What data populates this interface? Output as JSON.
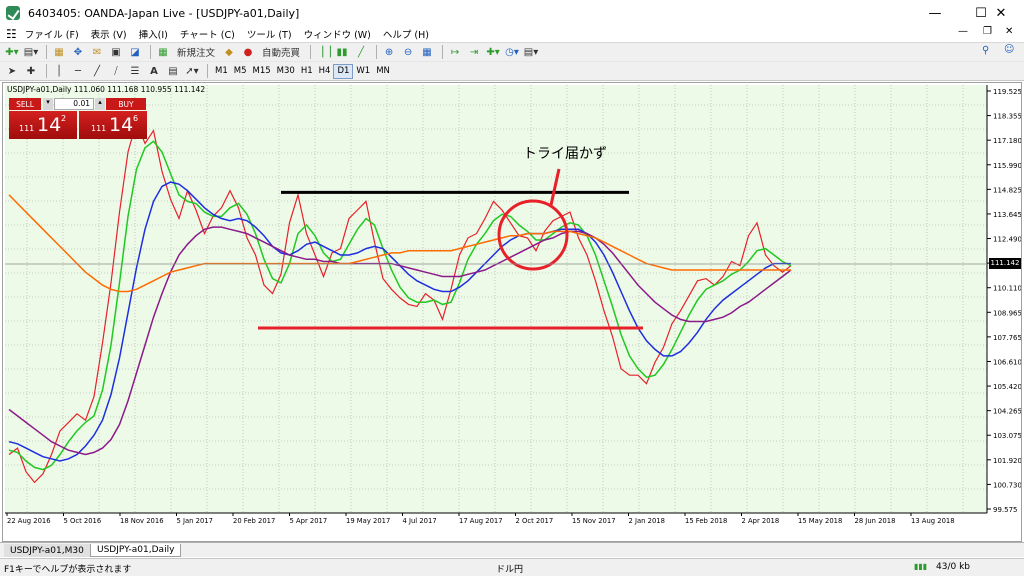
{
  "window": {
    "title": "6403405: OANDA-Japan Live - [USDJPY-a01,Daily]"
  },
  "menu": [
    "ファイル (F)",
    "表示 (V)",
    "挿入(I)",
    "チャート (C)",
    "ツール (T)",
    "ウィンドウ (W)",
    "ヘルプ (H)"
  ],
  "toolbar": {
    "new_order": "新規注文",
    "auto_trade": "自動売買"
  },
  "timeframes": [
    "M1",
    "M5",
    "M15",
    "M30",
    "H1",
    "H4",
    "D1",
    "W1",
    "MN"
  ],
  "active_timeframe": "D1",
  "chart": {
    "symbol_label": "USDJPY-a01,Daily",
    "ohlc": "111.060 111.168 110.955 111.142",
    "trade_panel": {
      "sell_label": "SELL",
      "buy_label": "BUY",
      "lot": "0.01",
      "sell_prefix": "111",
      "sell_big": "14",
      "sell_sup": "2",
      "buy_prefix": "111",
      "buy_big": "14",
      "buy_sup": "6"
    },
    "annotation": "トライ届かず",
    "current_price": "111.142"
  },
  "chart_data": {
    "type": "line",
    "price_axis_labels": [
      "119.525",
      "118.355",
      "117.180",
      "115.990",
      "114.825",
      "113.645",
      "112.490",
      "111.142",
      "110.110",
      "108.965",
      "107.765",
      "106.610",
      "105.420",
      "104.265",
      "103.075",
      "101.920",
      "100.730",
      "99.575"
    ],
    "date_axis_labels": [
      "22 Aug 2016",
      "5 Oct 2016",
      "18 Nov 2016",
      "5 Jan 2017",
      "20 Feb 2017",
      "5 Apr 2017",
      "19 May 2017",
      "4 Jul 2017",
      "17 Aug 2017",
      "2 Oct 2017",
      "15 Nov 2017",
      "2 Jan 2018",
      "15 Feb 2018",
      "2 Apr 2018",
      "15 May 2018",
      "28 Jun 2018",
      "13 Aug 2018"
    ],
    "ylim": [
      99.575,
      119.525
    ],
    "grid": true,
    "horizontal_lines": [
      {
        "price": 114.52,
        "color": "#000000"
      },
      {
        "price": 108.2,
        "color": "#e8202a"
      }
    ],
    "series": [
      {
        "color": "#e8202a",
        "values": [
          102.3,
          102.6,
          101.5,
          101.0,
          101.4,
          102.3,
          103.4,
          103.8,
          104.2,
          103.9,
          105.0,
          107.5,
          110.3,
          113.6,
          116.4,
          117.8,
          116.8,
          117.4,
          115.5,
          114.2,
          113.3,
          114.6,
          113.7,
          112.6,
          113.4,
          113.8,
          114.6,
          113.8,
          112.4,
          111.6,
          110.2,
          109.8,
          110.7,
          113.1,
          114.4,
          112.6,
          111.6,
          110.6,
          111.7,
          111.9,
          113.3,
          113.7,
          114.1,
          112.2,
          110.5,
          110.0,
          109.6,
          109.3,
          109.2,
          109.8,
          109.5,
          108.6,
          110.0,
          111.6,
          112.4,
          112.6,
          113.3,
          114.1,
          113.7,
          113.1,
          112.5,
          112.4,
          111.8,
          112.7,
          113.2,
          113.4,
          113.6,
          112.4,
          111.6,
          110.4,
          109.0,
          107.8,
          106.3,
          106.0,
          106.0,
          105.6,
          106.6,
          107.3,
          108.4,
          109.0,
          109.7,
          110.4,
          110.5,
          110.2,
          110.6,
          111.3,
          111.1,
          112.5,
          113.1,
          111.6,
          111.1,
          110.8,
          111.1
        ]
      },
      {
        "color": "#22c822",
        "values": [
          102.5,
          102.4,
          102.0,
          101.7,
          101.6,
          101.8,
          102.3,
          102.9,
          103.4,
          103.8,
          104.1,
          105.3,
          107.4,
          110.3,
          113.4,
          115.6,
          116.6,
          116.9,
          116.4,
          115.4,
          114.4,
          114.1,
          114.0,
          113.6,
          113.4,
          113.4,
          113.8,
          114.0,
          113.5,
          112.6,
          111.4,
          110.5,
          110.3,
          111.2,
          112.6,
          113.0,
          112.5,
          111.7,
          111.3,
          111.4,
          112.1,
          112.8,
          113.3,
          113.0,
          111.9,
          110.9,
          110.1,
          109.6,
          109.4,
          109.4,
          109.5,
          109.3,
          109.4,
          110.3,
          111.4,
          112.1,
          112.6,
          113.2,
          113.5,
          113.4,
          113.0,
          112.7,
          112.3,
          112.3,
          112.6,
          112.9,
          113.1,
          113.0,
          112.5,
          111.6,
          110.4,
          109.2,
          107.9,
          106.9,
          106.3,
          105.9,
          106.0,
          106.5,
          107.2,
          108.0,
          108.8,
          109.5,
          110.0,
          110.2,
          110.4,
          110.7,
          110.9,
          111.3,
          111.8,
          111.9,
          111.6,
          111.3,
          111.1
        ]
      },
      {
        "color": "#1e2ee0",
        "values": [
          102.9,
          102.8,
          102.6,
          102.4,
          102.2,
          102.1,
          102.0,
          102.1,
          102.3,
          102.7,
          103.2,
          103.9,
          105.1,
          106.8,
          108.9,
          111.0,
          112.8,
          114.1,
          114.8,
          115.0,
          114.9,
          114.6,
          114.2,
          113.8,
          113.5,
          113.3,
          113.2,
          113.3,
          113.2,
          112.9,
          112.5,
          112.0,
          111.7,
          111.6,
          111.8,
          112.1,
          112.2,
          112.0,
          111.8,
          111.6,
          111.6,
          111.7,
          111.9,
          112.0,
          111.9,
          111.5,
          111.1,
          110.7,
          110.4,
          110.2,
          110.0,
          109.9,
          109.9,
          110.1,
          110.4,
          110.8,
          111.2,
          111.6,
          112.0,
          112.3,
          112.5,
          112.6,
          112.6,
          112.6,
          112.7,
          112.8,
          112.8,
          112.8,
          112.6,
          112.2,
          111.6,
          110.8,
          109.9,
          109.0,
          108.2,
          107.6,
          107.2,
          106.9,
          106.9,
          107.1,
          107.5,
          108.0,
          108.6,
          109.1,
          109.5,
          109.8,
          110.1,
          110.4,
          110.7,
          111.0,
          111.2,
          111.2,
          111.2
        ]
      },
      {
        "color": "#8b1a8b",
        "values": [
          104.4,
          104.1,
          103.8,
          103.5,
          103.2,
          102.9,
          102.7,
          102.5,
          102.4,
          102.3,
          102.4,
          102.6,
          103.0,
          103.7,
          104.8,
          106.1,
          107.4,
          108.7,
          109.8,
          110.8,
          111.6,
          112.1,
          112.5,
          112.8,
          112.9,
          112.9,
          112.8,
          112.7,
          112.6,
          112.4,
          112.2,
          112.0,
          111.8,
          111.6,
          111.5,
          111.4,
          111.4,
          111.3,
          111.3,
          111.2,
          111.2,
          111.2,
          111.2,
          111.2,
          111.2,
          111.2,
          111.1,
          111.0,
          110.9,
          110.8,
          110.7,
          110.6,
          110.6,
          110.6,
          110.7,
          110.8,
          110.9,
          111.1,
          111.3,
          111.5,
          111.7,
          111.9,
          112.1,
          112.3,
          112.4,
          112.6,
          112.7,
          112.7,
          112.6,
          112.4,
          112.1,
          111.7,
          111.2,
          110.7,
          110.2,
          109.8,
          109.4,
          109.1,
          108.8,
          108.6,
          108.5,
          108.5,
          108.5,
          108.6,
          108.7,
          108.9,
          109.2,
          109.4,
          109.7,
          110.0,
          110.3,
          110.6,
          110.9
        ]
      },
      {
        "color": "#ff6a00",
        "values": [
          114.4,
          114.0,
          113.6,
          113.2,
          112.8,
          112.4,
          112.0,
          111.6,
          111.2,
          110.8,
          110.5,
          110.2,
          110.0,
          109.9,
          109.9,
          110.0,
          110.2,
          110.4,
          110.6,
          110.8,
          110.9,
          111.0,
          111.1,
          111.2,
          111.2,
          111.2,
          111.2,
          111.2,
          111.2,
          111.2,
          111.2,
          111.2,
          111.2,
          111.2,
          111.2,
          111.2,
          111.2,
          111.2,
          111.2,
          111.2,
          111.2,
          111.3,
          111.4,
          111.5,
          111.6,
          111.7,
          111.7,
          111.8,
          111.8,
          111.8,
          111.8,
          111.8,
          111.8,
          111.9,
          112.0,
          112.1,
          112.2,
          112.3,
          112.4,
          112.5,
          112.5,
          112.6,
          112.6,
          112.6,
          112.7,
          112.7,
          112.7,
          112.6,
          112.5,
          112.4,
          112.2,
          112.0,
          111.8,
          111.6,
          111.4,
          111.2,
          111.1,
          111.0,
          110.9,
          110.9,
          110.9,
          110.9,
          110.9,
          110.9,
          110.9,
          110.9,
          110.9,
          110.9,
          110.9,
          110.9,
          110.9,
          110.9,
          110.9
        ]
      }
    ]
  },
  "tabs": [
    "USDJPY-a01,M30",
    "USDJPY-a01,Daily"
  ],
  "active_tab": "USDJPY-a01,Daily",
  "status": {
    "help": "F1キーでヘルプが表示されます",
    "profile": "ドル円",
    "traffic": "43/0 kb"
  }
}
